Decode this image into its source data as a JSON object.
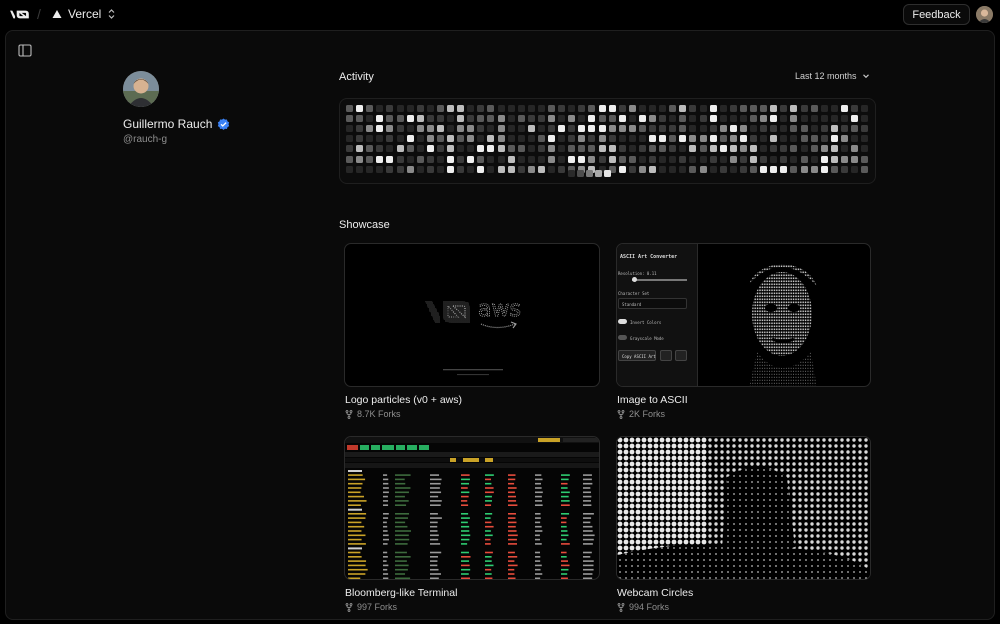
{
  "topbar": {
    "team_name": "Vercel",
    "feedback_label": "Feedback"
  },
  "profile": {
    "name": "Guillermo Rauch",
    "handle": "@rauch-g"
  },
  "activity": {
    "title": "Activity",
    "range_label": "Last 12 months"
  },
  "showcase": {
    "title": "Showcase",
    "items": [
      {
        "title": "Logo particles (v0 + aws)",
        "forks": "8.7K Forks"
      },
      {
        "title": "Image to ASCII",
        "forks": "2K Forks"
      },
      {
        "title": "Bloomberg-like Terminal",
        "forks": "997 Forks"
      },
      {
        "title": "Webcam Circles",
        "forks": "994 Forks"
      }
    ]
  },
  "ascii_panel": {
    "title": "ASCII Art Converter",
    "resolution_label": "Resolution: 0.11",
    "charset_label": "Character Set",
    "charset_value": "Standard",
    "invert_label": "Invert Colors",
    "grayscale_label": "Grayscale Mode",
    "copy_label": "Copy ASCII Art"
  },
  "colors": {
    "background": "#000000",
    "panel": "#0a0a0a",
    "border": "#1f1f1f",
    "muted_text": "#8f8f8f",
    "verified_blue": "#3b82f6"
  },
  "icons": [
    "v0-logo",
    "vercel-triangle-icon",
    "chevrons-updown-icon",
    "sidebar-toggle-icon",
    "verified-badge-icon",
    "chevron-down-icon",
    "fork-icon"
  ]
}
